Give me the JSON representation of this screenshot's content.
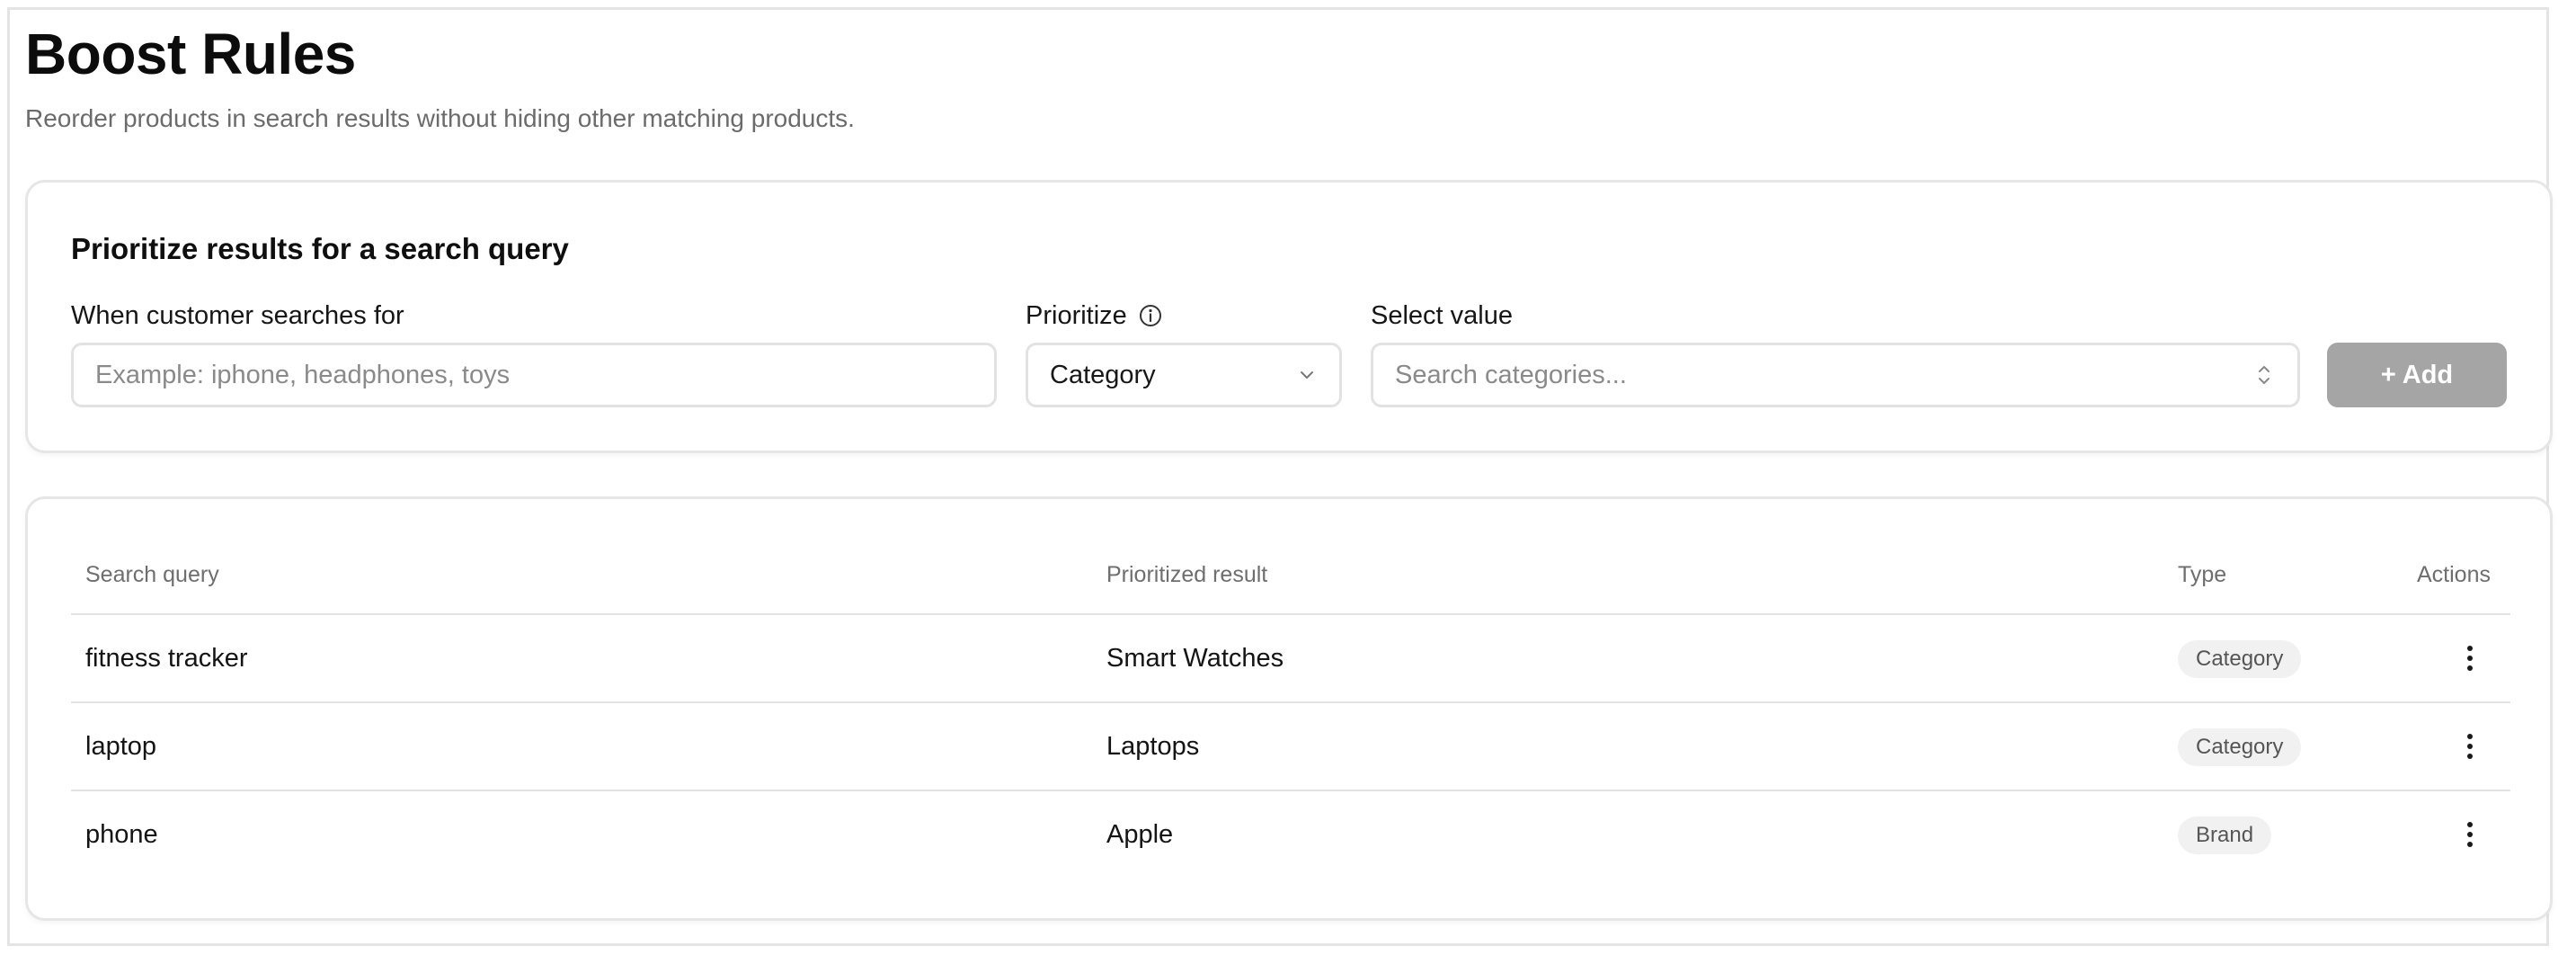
{
  "page": {
    "title": "Boost Rules",
    "subtitle": "Reorder products in search results without hiding other matching products."
  },
  "form": {
    "title": "Prioritize results for a search query",
    "query_label": "When customer searches for",
    "query_placeholder": "Example: iphone, headphones, toys",
    "query_value": "",
    "prioritize_label": "Prioritize",
    "prioritize_value": "Category",
    "select_value_label": "Select value",
    "select_value_placeholder": "Search categories...",
    "add_label": "+ Add"
  },
  "table": {
    "columns": [
      "Search query",
      "Prioritized result",
      "Type",
      "Actions"
    ],
    "rows": [
      {
        "query": "fitness tracker",
        "result": "Smart Watches",
        "type": "Category"
      },
      {
        "query": "laptop",
        "result": "Laptops",
        "type": "Category"
      },
      {
        "query": "phone",
        "result": "Apple",
        "type": "Brand"
      }
    ]
  },
  "colors": {
    "add_button_bg": "#a5a5a5",
    "badge_bg": "#f1f1f1",
    "border": "#e4e4e4"
  },
  "icons": {
    "prioritize_info": "info-circle-icon",
    "prioritize_dropdown": "chevron-down-icon",
    "select_value": "chevron-up-down-icon",
    "row_actions": "more-vertical-icon"
  }
}
